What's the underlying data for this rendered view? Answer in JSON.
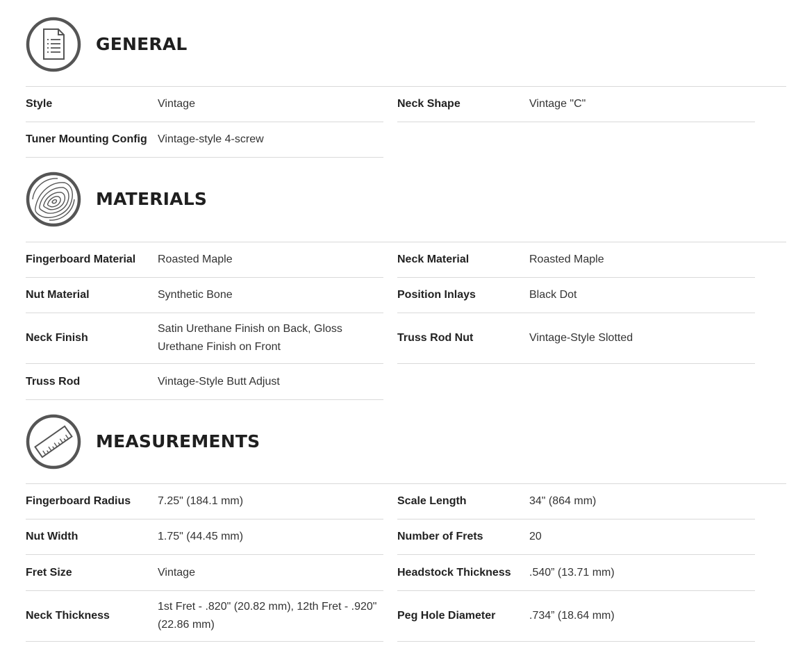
{
  "sections": {
    "general": {
      "title": "GENERAL",
      "icon": "document-list-icon",
      "left": [
        {
          "label": "Style",
          "value": "Vintage"
        },
        {
          "label": "Tuner Mounting Config",
          "value": "Vintage-style 4-screw"
        }
      ],
      "right": [
        {
          "label": "Neck Shape",
          "value": "Vintage \"C\""
        }
      ]
    },
    "materials": {
      "title": "MATERIALS",
      "icon": "wood-grain-icon",
      "left": [
        {
          "label": "Fingerboard Material",
          "value": "Roasted Maple"
        },
        {
          "label": "Nut Material",
          "value": "Synthetic Bone"
        },
        {
          "label": "Neck Finish",
          "value": "Satin Urethane Finish on Back, Gloss Urethane Finish on Front"
        },
        {
          "label": "Truss Rod",
          "value": "Vintage-Style Butt Adjust"
        }
      ],
      "right": [
        {
          "label": "Neck Material",
          "value": "Roasted Maple"
        },
        {
          "label": "Position Inlays",
          "value": "Black Dot"
        },
        {
          "label": "Truss Rod Nut",
          "value": "Vintage-Style Slotted"
        }
      ]
    },
    "measurements": {
      "title": "MEASUREMENTS",
      "icon": "ruler-icon",
      "left": [
        {
          "label": "Fingerboard Radius",
          "value": "7.25\" (184.1 mm)"
        },
        {
          "label": "Nut Width",
          "value": "1.75\" (44.45 mm)"
        },
        {
          "label": "Fret Size",
          "value": "Vintage"
        },
        {
          "label": "Neck Thickness",
          "value": "1st Fret - .820\" (20.82 mm), 12th Fret - .920\" (22.86 mm)"
        }
      ],
      "right": [
        {
          "label": "Scale Length",
          "value": "34\" (864 mm)"
        },
        {
          "label": "Number of Frets",
          "value": "20"
        },
        {
          "label": "Headstock Thickness",
          "value": ".540” (13.71 mm)"
        },
        {
          "label": "Peg Hole Diameter",
          "value": ".734” (18.64 mm)"
        }
      ]
    }
  },
  "colors": {
    "icon_ring": "#555555",
    "rule": "#d9d9d9",
    "text": "#222222"
  }
}
